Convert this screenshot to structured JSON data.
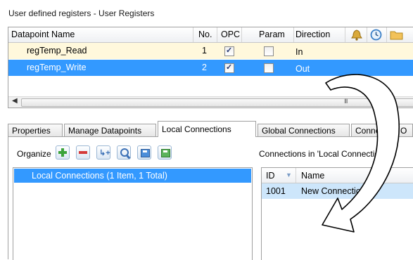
{
  "window": {
    "title": "User defined registers - User Registers"
  },
  "registers": {
    "columns": {
      "name": "Datapoint Name",
      "no": "No.",
      "opc": "OPC",
      "param": "Param",
      "direction": "Direction"
    },
    "rows": [
      {
        "name": "regTemp_Read",
        "no": "1",
        "opc_checked": true,
        "param_checked": false,
        "direction": "In",
        "selected": false
      },
      {
        "name": "regTemp_Write",
        "no": "2",
        "opc_checked": true,
        "param_checked": false,
        "direction": "Out",
        "selected": true
      }
    ],
    "header_icons": [
      "bell-icon",
      "clock-icon",
      "folder-icon"
    ],
    "scroll_grip": "III"
  },
  "tabs": [
    {
      "label": "Properties",
      "active": false
    },
    {
      "label": "Manage Datapoints",
      "active": false
    },
    {
      "label": "Local Connections",
      "active": true
    },
    {
      "label": "Global Connections",
      "active": false
    },
    {
      "label": "Connection O",
      "active": false
    }
  ],
  "organize": {
    "label": "Organize",
    "toolbar_icons": [
      "add-icon",
      "remove-icon",
      "link-icon",
      "search-icon",
      "import-icon",
      "export-icon"
    ],
    "list_item": "Local Connections (1 Item, 1 Total)"
  },
  "connections": {
    "title": "Connections in 'Local Connections'",
    "columns": {
      "id": "ID",
      "name": "Name"
    },
    "rows": [
      {
        "id": "1001",
        "name": "New Connection"
      }
    ]
  },
  "colors": {
    "selection": "#3399ff",
    "row_highlight": "#fff8dc",
    "connection_row": "#cde6fb"
  }
}
